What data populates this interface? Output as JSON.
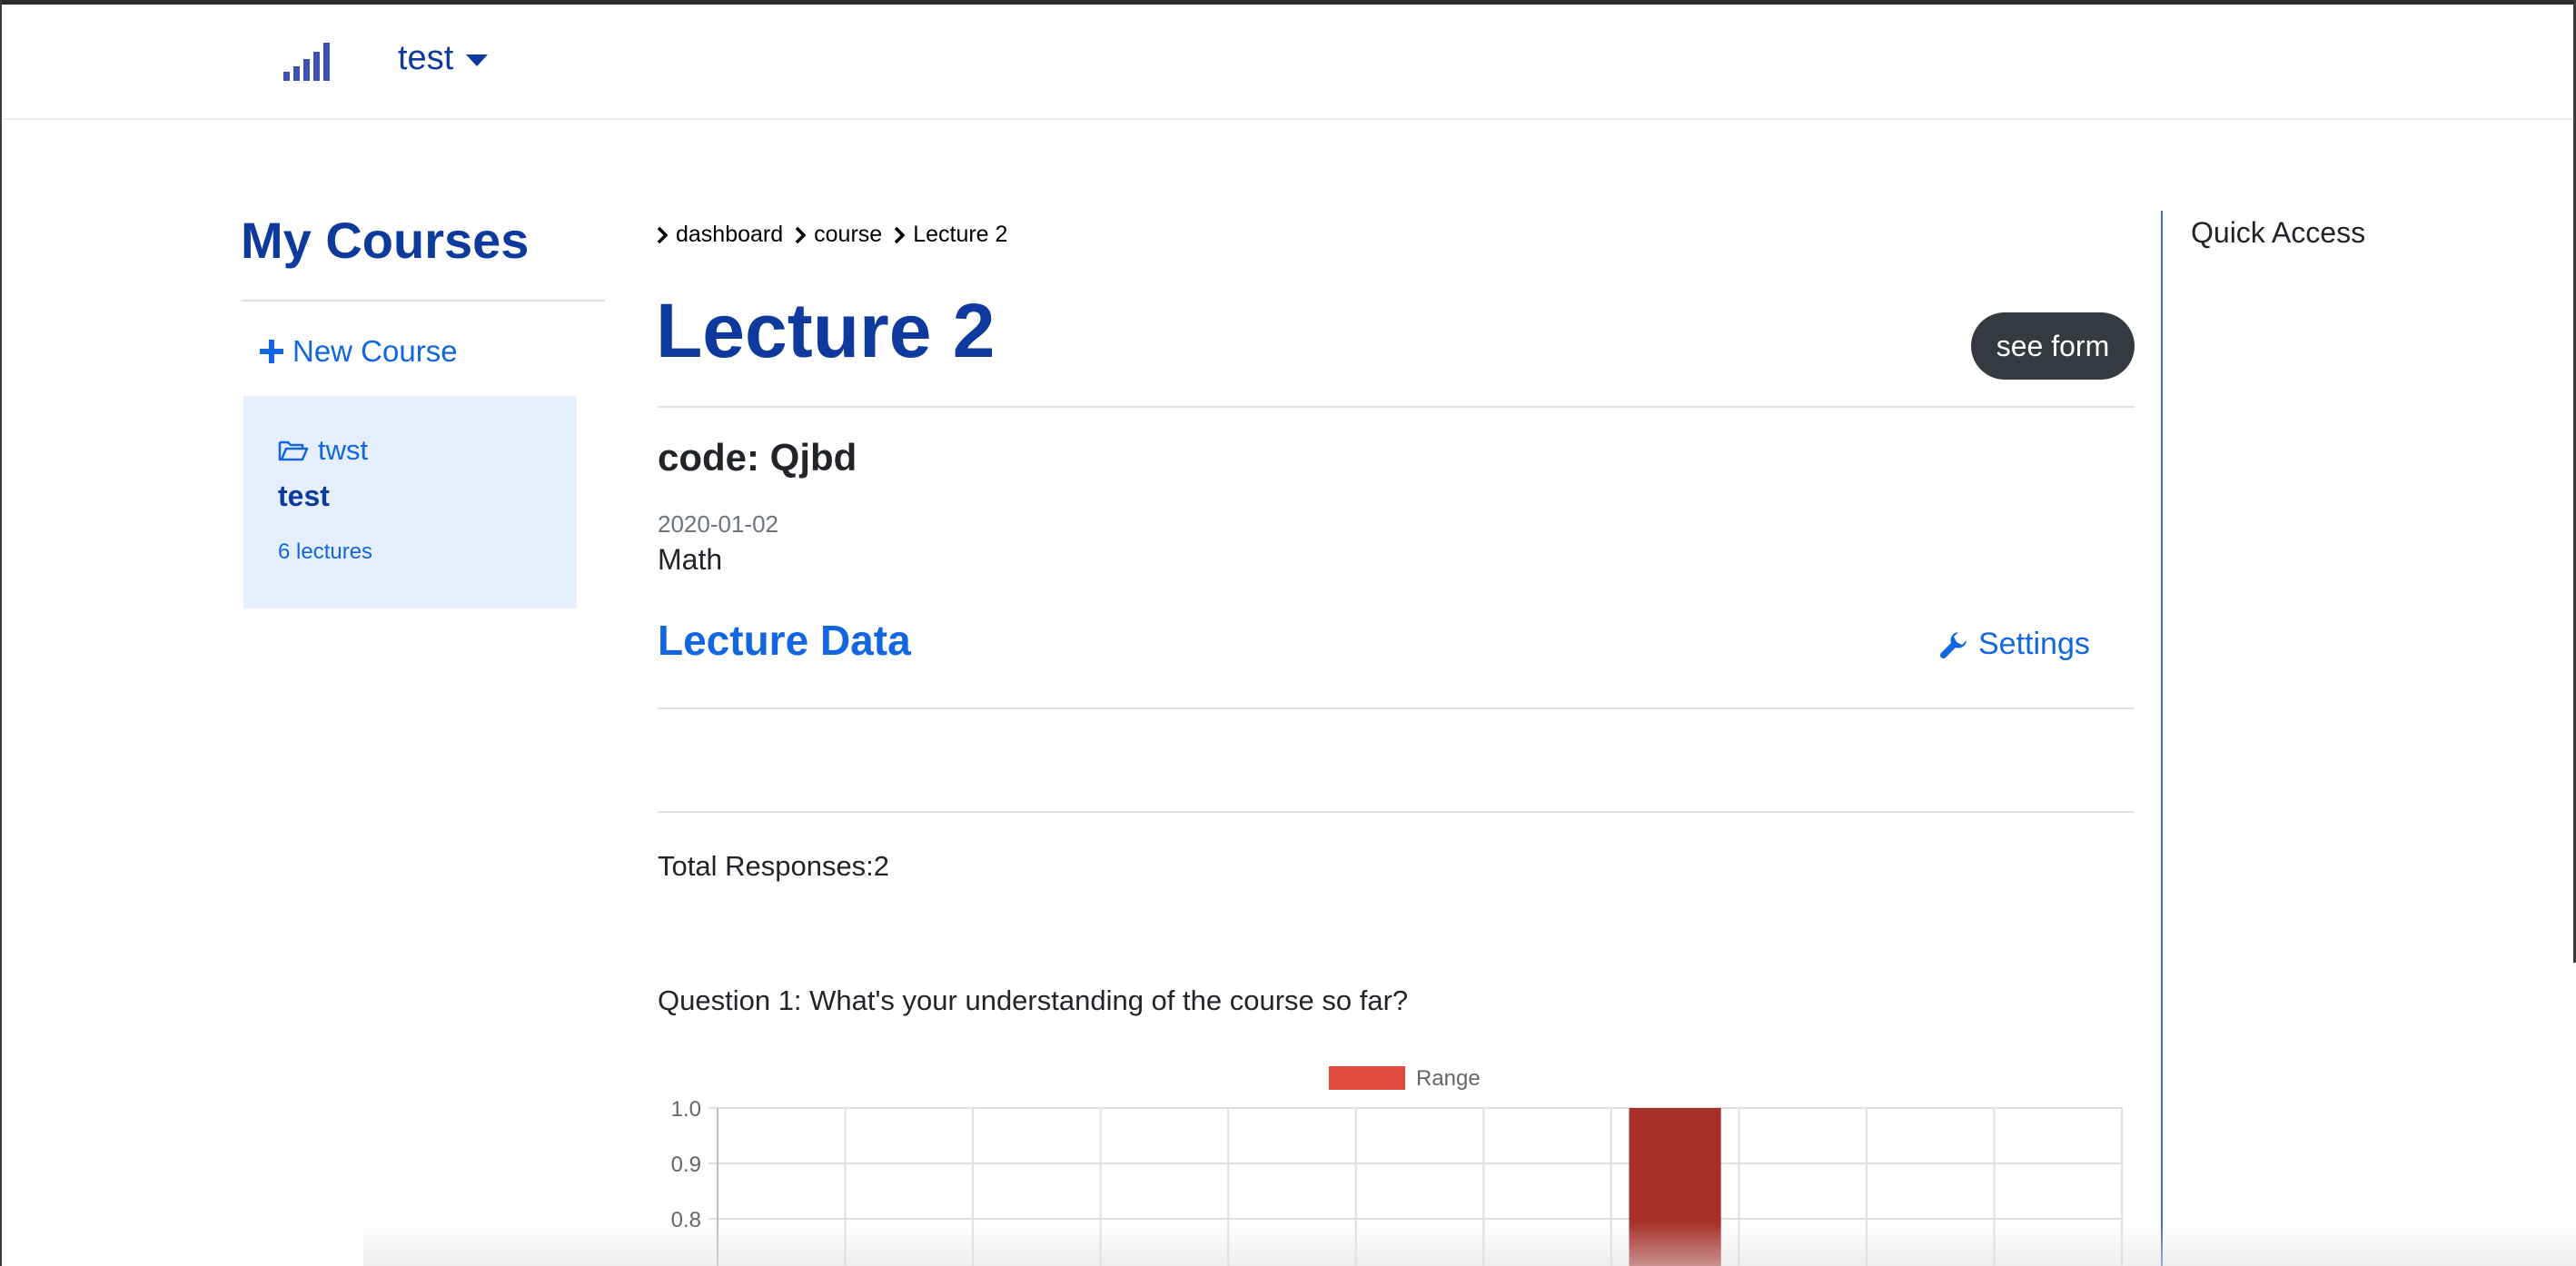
{
  "navbar": {
    "brand_icon": "signal-bars-icon",
    "user_menu_label": "test"
  },
  "sidebar": {
    "title": "My Courses",
    "new_course_label": "New Course",
    "courses": [
      {
        "code": "twst",
        "name": "test",
        "lecture_count": "6 lectures"
      }
    ]
  },
  "breadcrumb": [
    "dashboard",
    "course",
    "Lecture 2"
  ],
  "lecture": {
    "title": "Lecture 2",
    "see_form_label": "see form",
    "code_text": "code: Qjbd",
    "date": "2020-01-02",
    "subject": "Math",
    "data_heading": "Lecture Data",
    "settings_label": "Settings"
  },
  "responses": {
    "total_text": "Total Responses:2",
    "question_text": "Question 1: What's your understanding of the course so far?"
  },
  "quick_access": {
    "title": "Quick Access"
  },
  "colors": {
    "brand_dark": "#0d3a9c",
    "link_blue": "#1266e0",
    "card_bg": "#e6effd",
    "dark_button": "#343a40",
    "bar_fill": "#a8302a",
    "legend_swatch": "#e14b40"
  },
  "chart_data": {
    "type": "bar",
    "legend": [
      "Range"
    ],
    "legend_position": "top-center",
    "categories_count": 11,
    "series": [
      {
        "name": "Range",
        "values": [
          0,
          0,
          0,
          0,
          0,
          0,
          0,
          1.0,
          0,
          0,
          0
        ]
      }
    ],
    "visible_y_ticks": [
      "1.0",
      "0.9",
      "0.8"
    ],
    "ylim_visible": [
      0.8,
      1.0
    ],
    "grid": true
  }
}
